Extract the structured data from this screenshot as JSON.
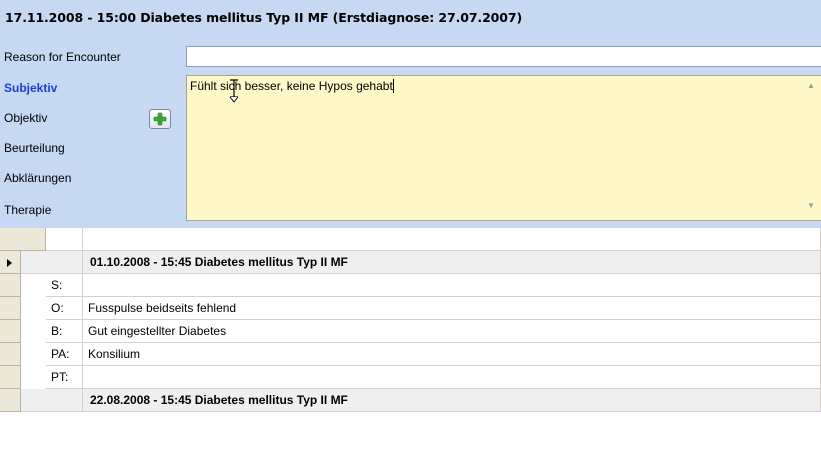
{
  "encounter": {
    "title": "17.11.2008 - 15:00 Diabetes mellitus Typ II MF (Erstdiagnose: 27.07.2007)"
  },
  "fields": {
    "reason_label": "Reason for Encounter",
    "reason_value": "",
    "subjektiv_label": "Subjektiv",
    "objektiv_label": "Objektiv",
    "beurteilung_label": "Beurteilung",
    "abklaerungen_label": "Abklärungen",
    "therapie_label": "Therapie"
  },
  "editor": {
    "text": "Fühlt sich besser, keine Hypos gehabt"
  },
  "icons": {
    "add": "plus-icon",
    "row_selector": "triangle-right-icon",
    "cursor": "ibeam-cursor-icon"
  },
  "colors": {
    "panel_bg": "#c6d8f2",
    "editor_bg": "#fff8c8",
    "active_label": "#1d3fd0",
    "group_row_bg": "#efefef",
    "add_icon_green": "#3fa83c"
  },
  "history": [
    {
      "title": "01.10.2008 - 15:45 Diabetes mellitus Typ II MF",
      "rows": [
        {
          "label": "S:",
          "text": ""
        },
        {
          "label": "O:",
          "text": "Fusspulse beidseits fehlend"
        },
        {
          "label": "B:",
          "text": "Gut eingestellter Diabetes"
        },
        {
          "label": "PA:",
          "text": "Konsilium"
        },
        {
          "label": "PT:",
          "text": ""
        }
      ]
    },
    {
      "title": "22.08.2008 - 15:45 Diabetes mellitus Typ II MF",
      "rows": []
    }
  ]
}
